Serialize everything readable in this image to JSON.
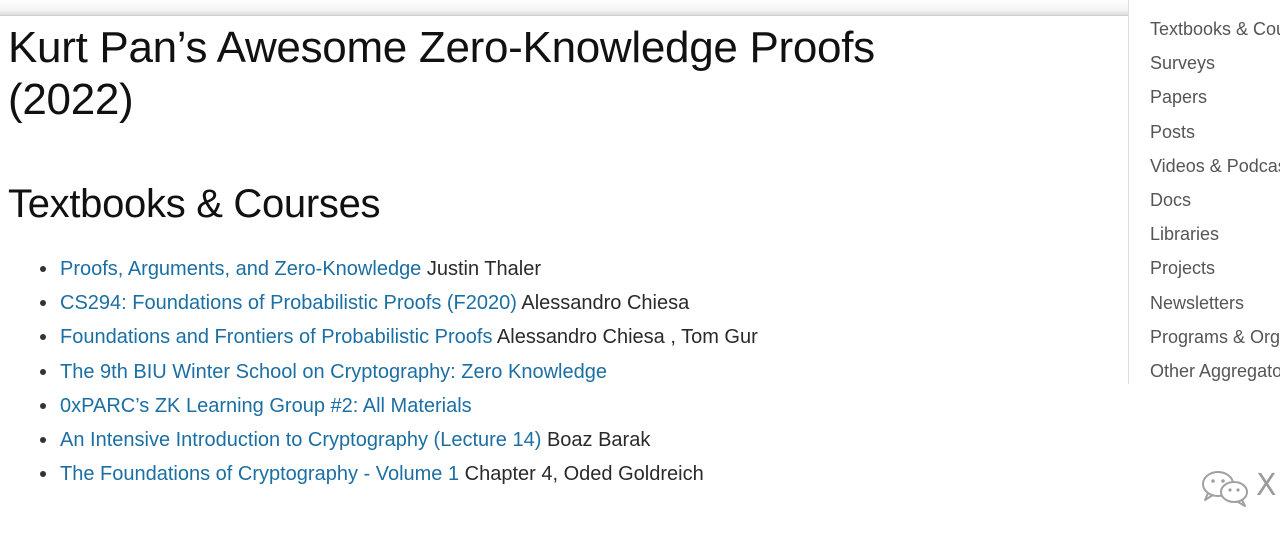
{
  "page": {
    "title": "Kurt Pan’s Awesome Zero-Knowledge Proofs (2022)"
  },
  "section": {
    "heading": "Textbooks & Courses",
    "items": [
      {
        "link": "Proofs, Arguments, and Zero-Knowledge",
        "author": " Justin Thaler"
      },
      {
        "link": "CS294: Foundations of Probabilistic Proofs (F2020)",
        "author": " Alessandro Chiesa"
      },
      {
        "link": "Foundations and Frontiers of Probabilistic Proofs",
        "author": " Alessandro Chiesa , Tom Gur"
      },
      {
        "link": "The 9th BIU Winter School on Cryptography: Zero Knowledge",
        "author": ""
      },
      {
        "link": "0xPARC’s ZK Learning Group #2: All Materials",
        "author": ""
      },
      {
        "link": "An Intensive Introduction to Cryptography (Lecture 14)",
        "author": " Boaz Barak"
      },
      {
        "link": "The Foundations of Cryptography - Volume 1",
        "author": " Chapter 4, Oded Goldreich"
      }
    ]
  },
  "toc": {
    "items": [
      "Textbooks & Cou",
      "Surveys",
      "Papers",
      "Posts",
      "Videos & Podcas",
      "Docs",
      "Libraries",
      "Projects",
      "Newsletters",
      "Programs & Org",
      "Other Aggregato"
    ]
  },
  "watermark": {
    "icon": "wechat-icon",
    "text": "X"
  },
  "colors": {
    "link": "#1b6fa3",
    "text": "#222222",
    "toc_text": "#555555"
  }
}
